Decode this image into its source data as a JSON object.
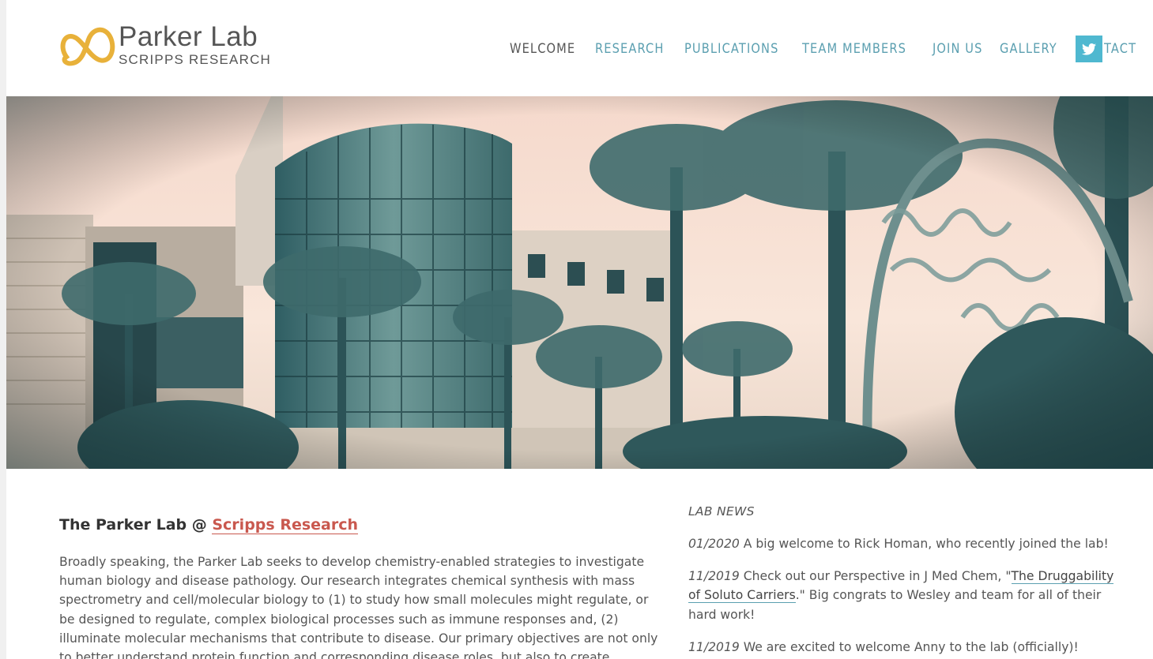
{
  "logo": {
    "title": "Parker Lab",
    "subtitle": "SCRIPPS RESEARCH"
  },
  "nav": {
    "items": [
      "WELCOME",
      "RESEARCH",
      "PUBLICATIONS",
      "TEAM MEMBERS",
      "JOIN US",
      "GALLERY",
      "CONTACT"
    ],
    "active": "WELCOME"
  },
  "social": {
    "icon": "twitter-icon"
  },
  "intro": {
    "title_prefix": "The Parker Lab @ ",
    "title_link": "Scripps Research",
    "body": "Broadly speaking, the Parker Lab seeks to develop chemistry-enabled strategies to investigate human biology and disease pathology. Our research integrates chemical synthesis with mass spectrometry and cell/molecular biology to (1) to study how small molecules might regulate, or be designed to regulate, complex biological processes such as immune responses and, (2) illuminate molecular mechanisms that contribute to disease. Our primary objectives are not only to better understand protein function and corresponding disease roles, but also to create chemical tools"
  },
  "news": {
    "heading": "LAB NEWS",
    "items": [
      {
        "date": "01/2020",
        "text": " A big welcome to Rick Homan, who recently joined the lab!"
      },
      {
        "date": "11/2019",
        "text_before": " Check out our Perspective in J Med Chem, \"",
        "link": "The Druggability of Soluto Carriers",
        "text_after": ".\" Big congrats to Wesley and team for all of their hard work!"
      },
      {
        "date": "11/2019",
        "text": " We are excited to welcome Anny to the lab (officially)!"
      }
    ]
  },
  "colors": {
    "accent": "#5b9fb0",
    "link_red": "#c9584e",
    "logo_gold": "#e8b13a",
    "twitter": "#4fb8d0"
  }
}
